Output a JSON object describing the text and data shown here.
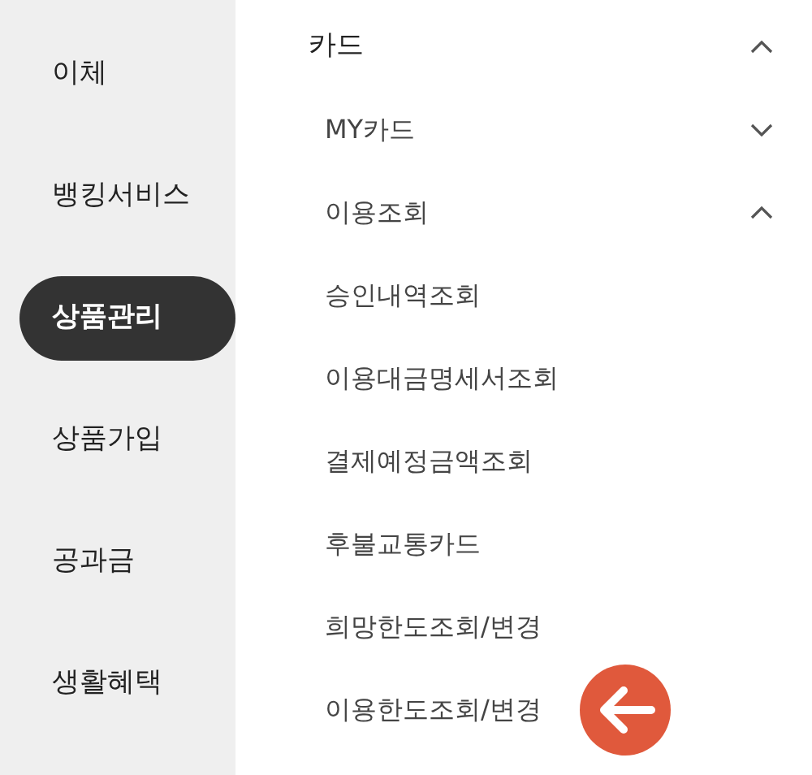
{
  "sidebar": {
    "items": [
      {
        "label": "이체",
        "selected": false
      },
      {
        "label": "뱅킹서비스",
        "selected": false
      },
      {
        "label": "상품관리",
        "selected": true
      },
      {
        "label": "상품가입",
        "selected": false
      },
      {
        "label": "공과금",
        "selected": false
      },
      {
        "label": "생활혜택",
        "selected": false
      }
    ]
  },
  "menu": {
    "title": "카드",
    "expanded": true,
    "children": [
      {
        "label": "MY카드",
        "expanded": false
      },
      {
        "label": "이용조회",
        "expanded": true,
        "children": [
          {
            "label": "승인내역조회",
            "highlighted": false
          },
          {
            "label": "이용대금명세서조회",
            "highlighted": false
          },
          {
            "label": "결제예정금액조회",
            "highlighted": false
          },
          {
            "label": "후불교통카드",
            "highlighted": false
          },
          {
            "label": "희망한도조회/변경",
            "highlighted": false
          },
          {
            "label": "이용한도조회/변경",
            "highlighted": true
          }
        ]
      }
    ]
  }
}
